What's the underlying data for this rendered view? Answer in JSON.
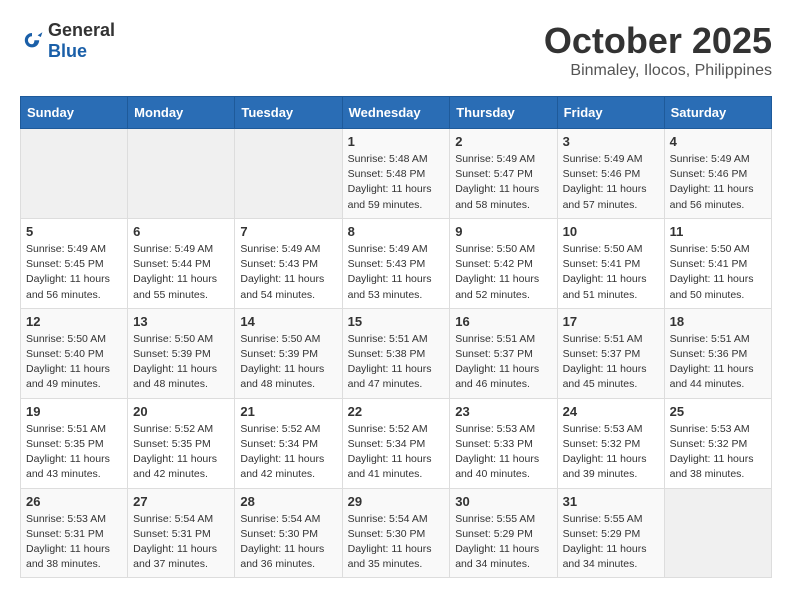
{
  "logo": {
    "general": "General",
    "blue": "Blue"
  },
  "title": "October 2025",
  "location": "Binmaley, Ilocos, Philippines",
  "weekdays": [
    "Sunday",
    "Monday",
    "Tuesday",
    "Wednesday",
    "Thursday",
    "Friday",
    "Saturday"
  ],
  "weeks": [
    [
      {
        "day": "",
        "sunrise": "",
        "sunset": "",
        "daylight": ""
      },
      {
        "day": "",
        "sunrise": "",
        "sunset": "",
        "daylight": ""
      },
      {
        "day": "",
        "sunrise": "",
        "sunset": "",
        "daylight": ""
      },
      {
        "day": "1",
        "sunrise": "Sunrise: 5:48 AM",
        "sunset": "Sunset: 5:48 PM",
        "daylight": "Daylight: 11 hours and 59 minutes."
      },
      {
        "day": "2",
        "sunrise": "Sunrise: 5:49 AM",
        "sunset": "Sunset: 5:47 PM",
        "daylight": "Daylight: 11 hours and 58 minutes."
      },
      {
        "day": "3",
        "sunrise": "Sunrise: 5:49 AM",
        "sunset": "Sunset: 5:46 PM",
        "daylight": "Daylight: 11 hours and 57 minutes."
      },
      {
        "day": "4",
        "sunrise": "Sunrise: 5:49 AM",
        "sunset": "Sunset: 5:46 PM",
        "daylight": "Daylight: 11 hours and 56 minutes."
      }
    ],
    [
      {
        "day": "5",
        "sunrise": "Sunrise: 5:49 AM",
        "sunset": "Sunset: 5:45 PM",
        "daylight": "Daylight: 11 hours and 56 minutes."
      },
      {
        "day": "6",
        "sunrise": "Sunrise: 5:49 AM",
        "sunset": "Sunset: 5:44 PM",
        "daylight": "Daylight: 11 hours and 55 minutes."
      },
      {
        "day": "7",
        "sunrise": "Sunrise: 5:49 AM",
        "sunset": "Sunset: 5:43 PM",
        "daylight": "Daylight: 11 hours and 54 minutes."
      },
      {
        "day": "8",
        "sunrise": "Sunrise: 5:49 AM",
        "sunset": "Sunset: 5:43 PM",
        "daylight": "Daylight: 11 hours and 53 minutes."
      },
      {
        "day": "9",
        "sunrise": "Sunrise: 5:50 AM",
        "sunset": "Sunset: 5:42 PM",
        "daylight": "Daylight: 11 hours and 52 minutes."
      },
      {
        "day": "10",
        "sunrise": "Sunrise: 5:50 AM",
        "sunset": "Sunset: 5:41 PM",
        "daylight": "Daylight: 11 hours and 51 minutes."
      },
      {
        "day": "11",
        "sunrise": "Sunrise: 5:50 AM",
        "sunset": "Sunset: 5:41 PM",
        "daylight": "Daylight: 11 hours and 50 minutes."
      }
    ],
    [
      {
        "day": "12",
        "sunrise": "Sunrise: 5:50 AM",
        "sunset": "Sunset: 5:40 PM",
        "daylight": "Daylight: 11 hours and 49 minutes."
      },
      {
        "day": "13",
        "sunrise": "Sunrise: 5:50 AM",
        "sunset": "Sunset: 5:39 PM",
        "daylight": "Daylight: 11 hours and 48 minutes."
      },
      {
        "day": "14",
        "sunrise": "Sunrise: 5:50 AM",
        "sunset": "Sunset: 5:39 PM",
        "daylight": "Daylight: 11 hours and 48 minutes."
      },
      {
        "day": "15",
        "sunrise": "Sunrise: 5:51 AM",
        "sunset": "Sunset: 5:38 PM",
        "daylight": "Daylight: 11 hours and 47 minutes."
      },
      {
        "day": "16",
        "sunrise": "Sunrise: 5:51 AM",
        "sunset": "Sunset: 5:37 PM",
        "daylight": "Daylight: 11 hours and 46 minutes."
      },
      {
        "day": "17",
        "sunrise": "Sunrise: 5:51 AM",
        "sunset": "Sunset: 5:37 PM",
        "daylight": "Daylight: 11 hours and 45 minutes."
      },
      {
        "day": "18",
        "sunrise": "Sunrise: 5:51 AM",
        "sunset": "Sunset: 5:36 PM",
        "daylight": "Daylight: 11 hours and 44 minutes."
      }
    ],
    [
      {
        "day": "19",
        "sunrise": "Sunrise: 5:51 AM",
        "sunset": "Sunset: 5:35 PM",
        "daylight": "Daylight: 11 hours and 43 minutes."
      },
      {
        "day": "20",
        "sunrise": "Sunrise: 5:52 AM",
        "sunset": "Sunset: 5:35 PM",
        "daylight": "Daylight: 11 hours and 42 minutes."
      },
      {
        "day": "21",
        "sunrise": "Sunrise: 5:52 AM",
        "sunset": "Sunset: 5:34 PM",
        "daylight": "Daylight: 11 hours and 42 minutes."
      },
      {
        "day": "22",
        "sunrise": "Sunrise: 5:52 AM",
        "sunset": "Sunset: 5:34 PM",
        "daylight": "Daylight: 11 hours and 41 minutes."
      },
      {
        "day": "23",
        "sunrise": "Sunrise: 5:53 AM",
        "sunset": "Sunset: 5:33 PM",
        "daylight": "Daylight: 11 hours and 40 minutes."
      },
      {
        "day": "24",
        "sunrise": "Sunrise: 5:53 AM",
        "sunset": "Sunset: 5:32 PM",
        "daylight": "Daylight: 11 hours and 39 minutes."
      },
      {
        "day": "25",
        "sunrise": "Sunrise: 5:53 AM",
        "sunset": "Sunset: 5:32 PM",
        "daylight": "Daylight: 11 hours and 38 minutes."
      }
    ],
    [
      {
        "day": "26",
        "sunrise": "Sunrise: 5:53 AM",
        "sunset": "Sunset: 5:31 PM",
        "daylight": "Daylight: 11 hours and 38 minutes."
      },
      {
        "day": "27",
        "sunrise": "Sunrise: 5:54 AM",
        "sunset": "Sunset: 5:31 PM",
        "daylight": "Daylight: 11 hours and 37 minutes."
      },
      {
        "day": "28",
        "sunrise": "Sunrise: 5:54 AM",
        "sunset": "Sunset: 5:30 PM",
        "daylight": "Daylight: 11 hours and 36 minutes."
      },
      {
        "day": "29",
        "sunrise": "Sunrise: 5:54 AM",
        "sunset": "Sunset: 5:30 PM",
        "daylight": "Daylight: 11 hours and 35 minutes."
      },
      {
        "day": "30",
        "sunrise": "Sunrise: 5:55 AM",
        "sunset": "Sunset: 5:29 PM",
        "daylight": "Daylight: 11 hours and 34 minutes."
      },
      {
        "day": "31",
        "sunrise": "Sunrise: 5:55 AM",
        "sunset": "Sunset: 5:29 PM",
        "daylight": "Daylight: 11 hours and 34 minutes."
      },
      {
        "day": "",
        "sunrise": "",
        "sunset": "",
        "daylight": ""
      }
    ]
  ]
}
